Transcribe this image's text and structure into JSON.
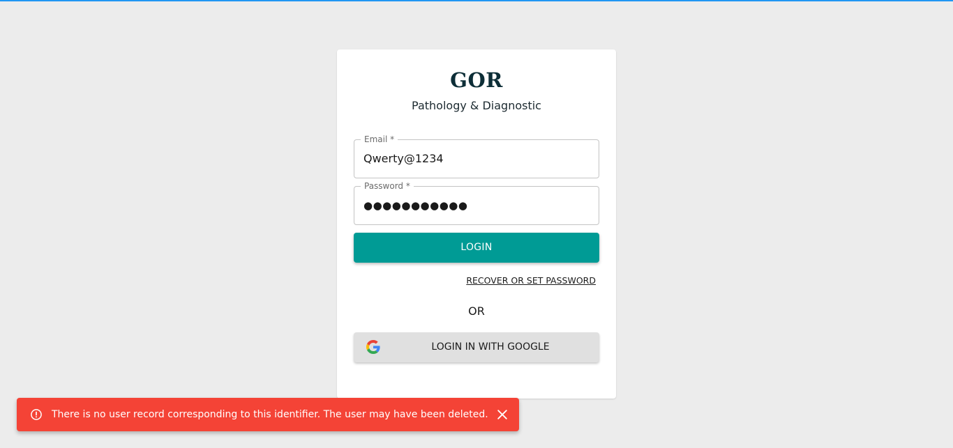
{
  "brand": {
    "name": "GOR",
    "subtitle": "Pathology & Diagnostic"
  },
  "form": {
    "email": {
      "label": "Email *",
      "value": "Qwerty@1234"
    },
    "password": {
      "label": "Password *",
      "value": "●●●●●●●●●●●"
    },
    "login_label": "LOGIN",
    "recover_label": "RECOVER OR SET PASSWORD",
    "or_label": "OR",
    "google_label": "LOGIN IN WITH GOOGLE"
  },
  "toast": {
    "message": "There is no user record corresponding to this identifier. The user may have been deleted.",
    "icon": "alert-circle-icon",
    "close_icon": "close-icon"
  },
  "colors": {
    "accent": "#009b95",
    "error": "#f44336",
    "top_bar": "#2196f3",
    "background": "#ececec"
  }
}
